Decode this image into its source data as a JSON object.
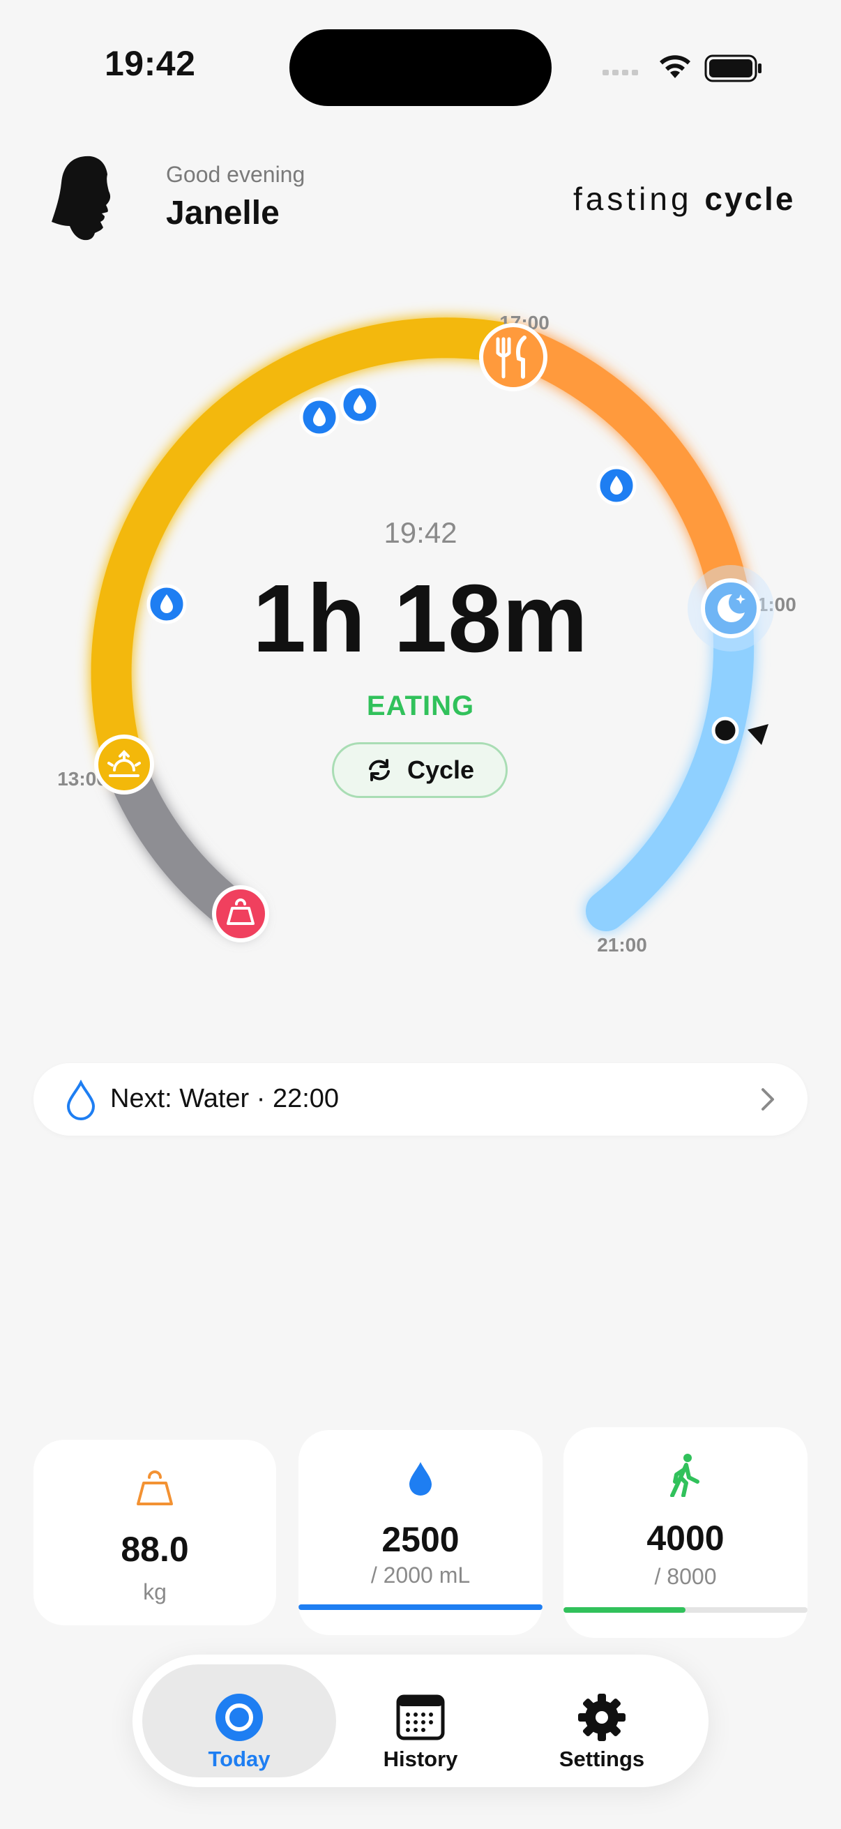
{
  "status_bar": {
    "time": "19:42"
  },
  "header": {
    "greeting": "Good evening",
    "name": "Janelle",
    "brand_prefix": "fasting",
    "brand_suffix": "cycle"
  },
  "dial": {
    "hour_labels": [
      "17:00",
      "13:00",
      "21:00",
      "21:00"
    ],
    "current_time": "19:42",
    "duration": "1h 18m",
    "state": "EATING",
    "cycle_button": "Cycle",
    "icons": [
      "fork-knife-icon",
      "sunrise-icon",
      "weight-icon",
      "moon-icon",
      "water-drop-icon"
    ],
    "colors": {
      "eating": "#f3b80a",
      "evening": "#ff9a3c",
      "fasting": "#8fd0ff",
      "pre": "#8e8e93",
      "water": "#1e7ef2",
      "weight": "#f0405e",
      "state_green": "#31c15b"
    }
  },
  "next": {
    "label": "Next: Water · 22:00"
  },
  "stats": {
    "weight": {
      "value": "88.0",
      "unit": "kg",
      "color": "#f39233"
    },
    "water": {
      "value": "2500",
      "target": "/ 2000 mL",
      "progress": 1.0,
      "color": "#1e7ef2"
    },
    "steps": {
      "value": "4000",
      "target": "/ 8000",
      "progress": 0.5,
      "color": "#31c15b"
    }
  },
  "tabs": [
    {
      "label": "Today",
      "icon": "circle-icon",
      "active": true
    },
    {
      "label": "History",
      "icon": "calendar-icon",
      "active": false
    },
    {
      "label": "Settings",
      "icon": "gear-icon",
      "active": false
    }
  ]
}
